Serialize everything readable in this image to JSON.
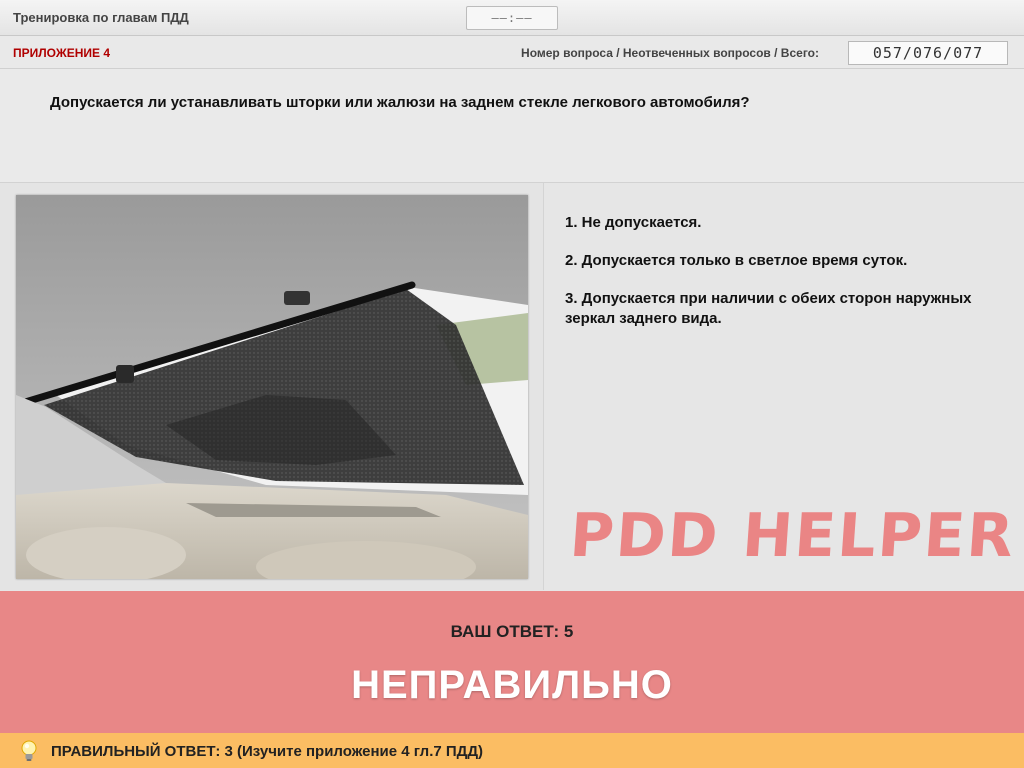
{
  "window": {
    "title": "Тренировка по главам ПДД",
    "timer": "––:––"
  },
  "subbar": {
    "appendix": "ПРИЛОЖЕНИЕ 4",
    "counter_label": "Номер вопроса / Неотвеченных вопросов / Всего:",
    "counter_value": "057/076/077"
  },
  "question": {
    "text": "Допускается ли устанавливать шторки или жалюзи на заднем стекле легкового автомобиля?"
  },
  "answers": [
    {
      "label": "1.  Не допускается."
    },
    {
      "label": "2.  Допускается только в светлое время суток."
    },
    {
      "label": "3.  Допускается при наличии с обеих сторон наружных зеркал заднего вида."
    }
  ],
  "brand": "PDD HELPER",
  "result": {
    "your_answer": "ВАШ  ОТВЕТ:   5",
    "verdict": "НЕПРАВИЛЬНО"
  },
  "hint": {
    "icon": "lightbulb-icon",
    "text": "ПРАВИЛЬНЫЙ ОТВЕТ:   3   (Изучите приложение 4 гл.7 ПДД)"
  },
  "colors": {
    "result_background": "#e88787",
    "hint_background": "#fbbd63",
    "appendix": "#b00000",
    "brand": "#ea8585"
  }
}
